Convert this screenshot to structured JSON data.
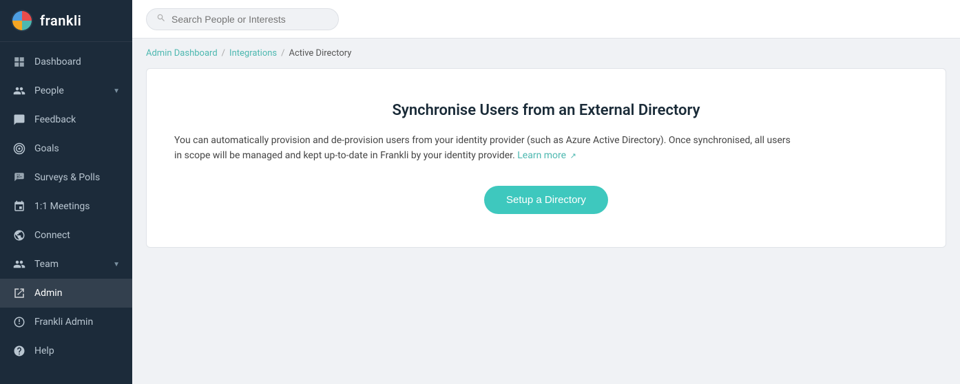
{
  "app": {
    "logo_text": "frankli"
  },
  "sidebar": {
    "items": [
      {
        "id": "dashboard",
        "label": "Dashboard",
        "active": false
      },
      {
        "id": "people",
        "label": "People",
        "active": false,
        "has_chevron": true
      },
      {
        "id": "feedback",
        "label": "Feedback",
        "active": false
      },
      {
        "id": "goals",
        "label": "Goals",
        "active": false
      },
      {
        "id": "surveys",
        "label": "Surveys & Polls",
        "active": false
      },
      {
        "id": "meetings",
        "label": "1:1 Meetings",
        "active": false
      },
      {
        "id": "connect",
        "label": "Connect",
        "active": false
      },
      {
        "id": "team",
        "label": "Team",
        "active": false,
        "has_chevron": true
      },
      {
        "id": "admin",
        "label": "Admin",
        "active": true
      },
      {
        "id": "frankli-admin",
        "label": "Frankli Admin",
        "active": false
      },
      {
        "id": "help",
        "label": "Help",
        "active": false
      }
    ]
  },
  "topbar": {
    "search_placeholder": "Search People or Interests"
  },
  "breadcrumb": {
    "items": [
      {
        "label": "Admin Dashboard",
        "link": true
      },
      {
        "label": "Integrations",
        "link": true
      },
      {
        "label": "Active Directory",
        "link": false
      }
    ]
  },
  "card": {
    "title": "Synchronise Users from an External Directory",
    "description_part1": "You can automatically provision and de-provision users from your identity provider (such as Azure Active Directory). Once synchronised, all users in scope will be managed and kept up-to-date in Frankli by your identity provider.",
    "learn_more_label": "Learn more",
    "setup_button_label": "Setup a Directory"
  }
}
